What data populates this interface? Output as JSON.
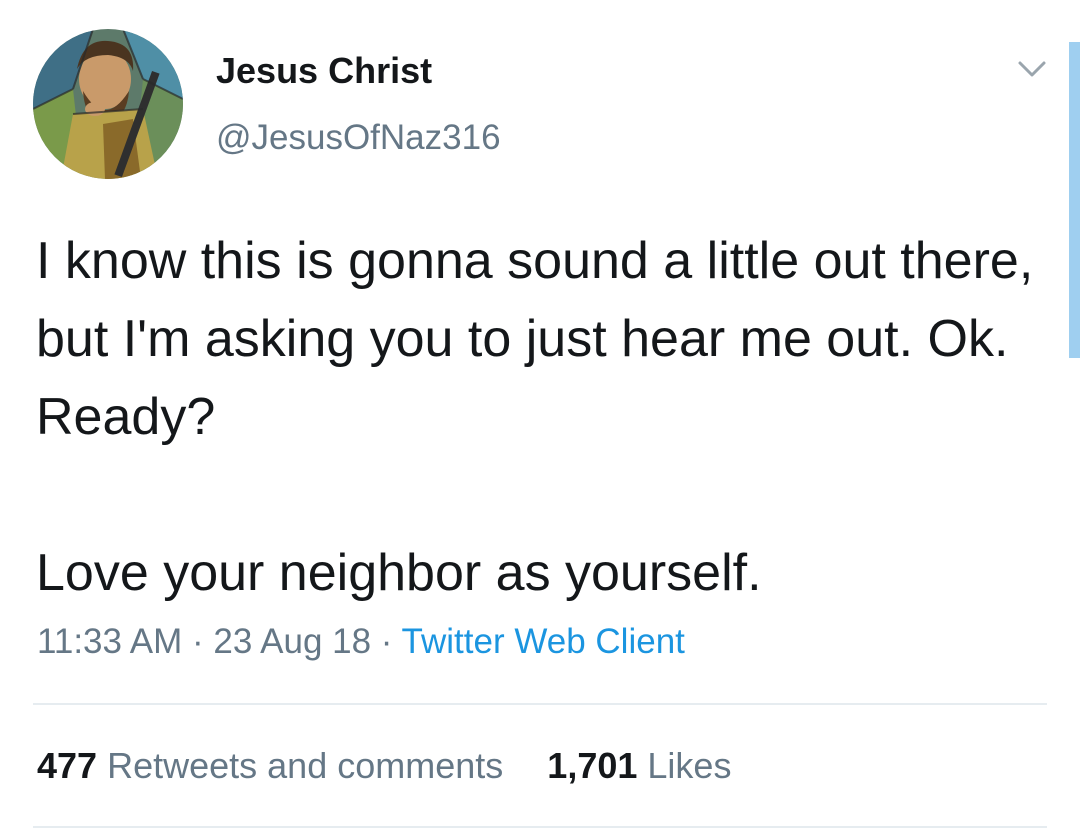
{
  "user": {
    "display_name": "Jesus Christ",
    "handle": "@JesusOfNaz316",
    "avatar": "stained-glass-portrait"
  },
  "tweet": {
    "paragraphs": [
      "I know this is gonna sound a little out there, but I'm asking you to just hear me out. Ok. Ready?",
      "Love your neighbor as yourself."
    ],
    "time": "11:33 AM",
    "separator": "·",
    "date": "23 Aug 18",
    "source": "Twitter Web Client"
  },
  "stats": {
    "retweets_count": "477",
    "retweets_label": "Retweets and comments",
    "likes_count": "1,701",
    "likes_label": "Likes"
  },
  "icons": {
    "caret": "chevron-down-icon"
  },
  "colors": {
    "text": "#14171a",
    "secondary": "#657786",
    "link": "#1b95e0",
    "divider": "#e6ecf0"
  }
}
